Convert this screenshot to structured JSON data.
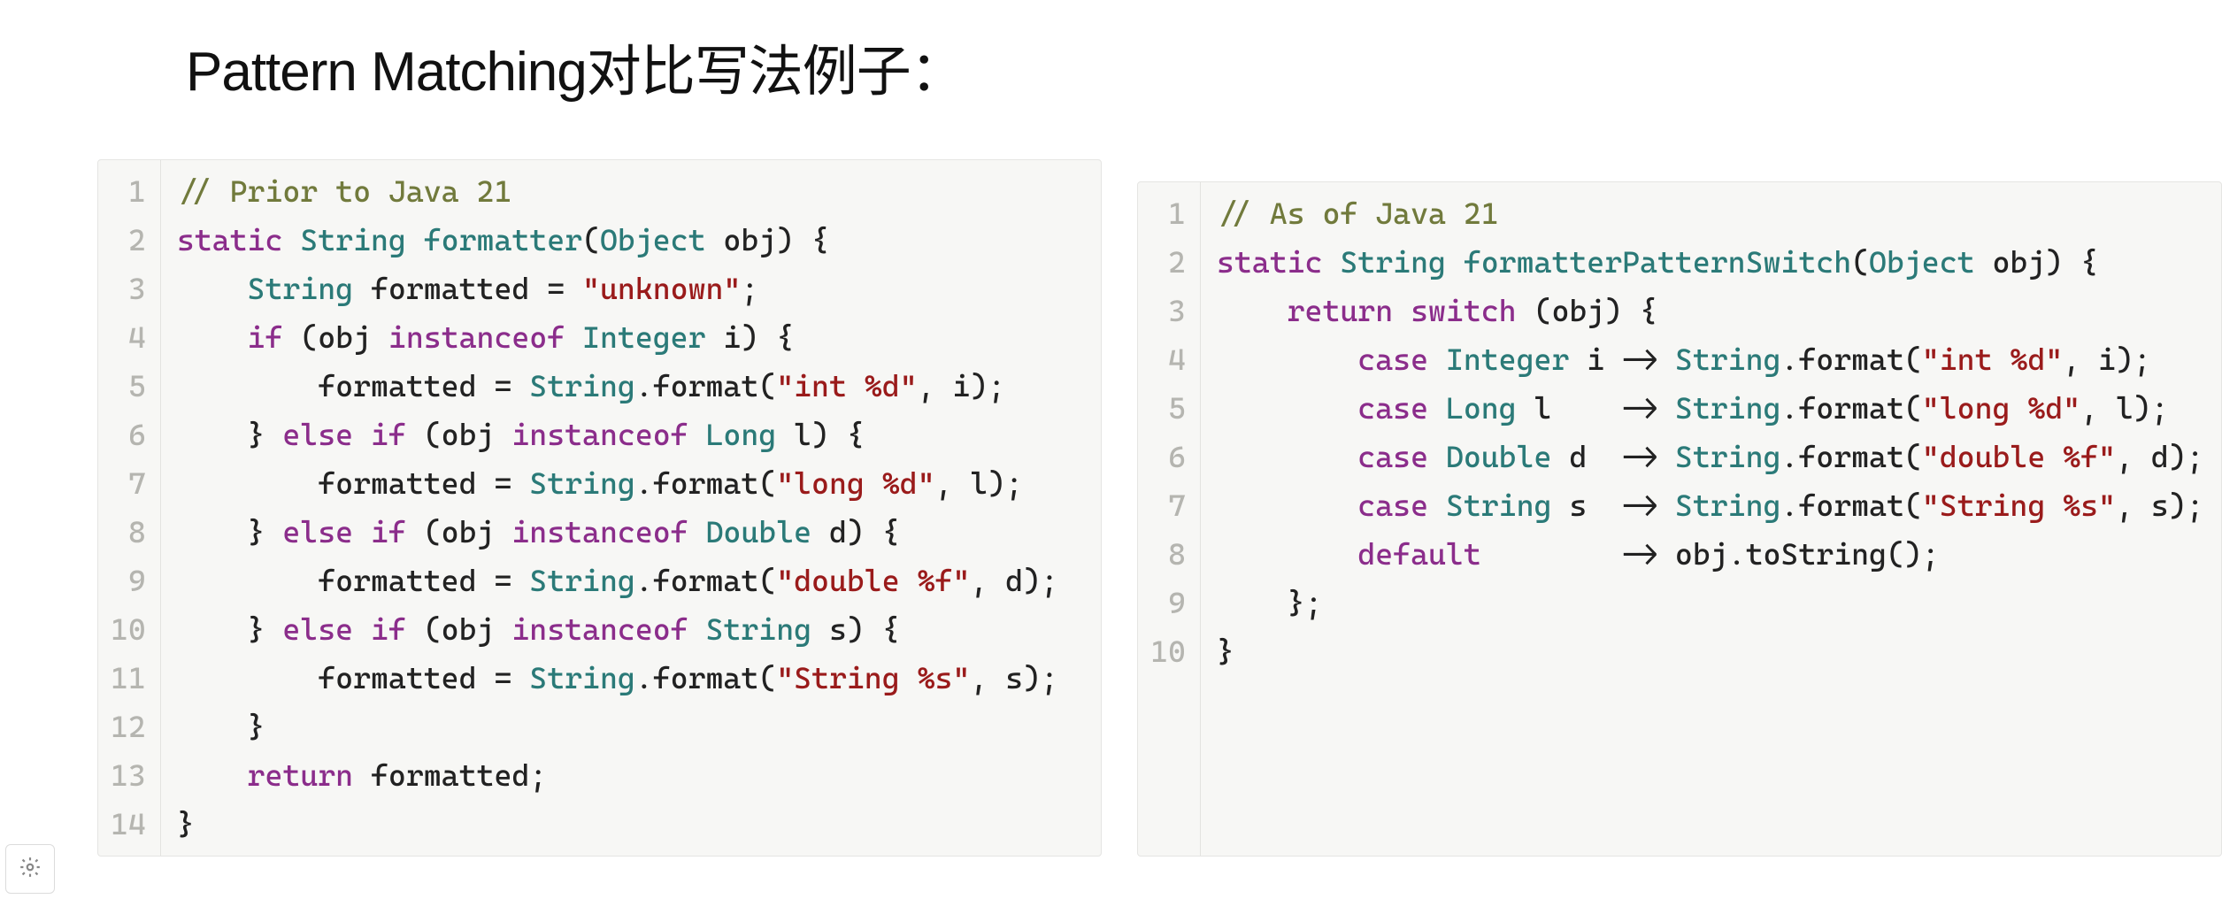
{
  "title": "Pattern Matching对比写法例子：",
  "left": {
    "comment_header": "// Prior to Java 21",
    "lines": [
      [
        {
          "t": "// Prior to Java 21",
          "c": "comment"
        }
      ],
      [
        {
          "t": "static ",
          "c": "keyword"
        },
        {
          "t": "String ",
          "c": "type"
        },
        {
          "t": "formatter",
          "c": "func"
        },
        {
          "t": "(",
          "c": "punct"
        },
        {
          "t": "Object ",
          "c": "type"
        },
        {
          "t": "obj",
          "c": "ident"
        },
        {
          "t": ") {",
          "c": "punct"
        }
      ],
      [
        {
          "t": "    ",
          "c": "punct"
        },
        {
          "t": "String ",
          "c": "type"
        },
        {
          "t": "formatted ",
          "c": "ident"
        },
        {
          "t": "= ",
          "c": "op"
        },
        {
          "t": "\"unknown\"",
          "c": "string"
        },
        {
          "t": ";",
          "c": "punct"
        }
      ],
      [
        {
          "t": "    ",
          "c": "punct"
        },
        {
          "t": "if ",
          "c": "keyword"
        },
        {
          "t": "(obj ",
          "c": "ident"
        },
        {
          "t": "instanceof ",
          "c": "keyword"
        },
        {
          "t": "Integer ",
          "c": "type"
        },
        {
          "t": "i) {",
          "c": "ident"
        }
      ],
      [
        {
          "t": "        formatted ",
          "c": "ident"
        },
        {
          "t": "= ",
          "c": "op"
        },
        {
          "t": "String",
          "c": "type"
        },
        {
          "t": ".format(",
          "c": "ident"
        },
        {
          "t": "\"int %d\"",
          "c": "string"
        },
        {
          "t": ", i);",
          "c": "ident"
        }
      ],
      [
        {
          "t": "    } ",
          "c": "punct"
        },
        {
          "t": "else if ",
          "c": "keyword"
        },
        {
          "t": "(obj ",
          "c": "ident"
        },
        {
          "t": "instanceof ",
          "c": "keyword"
        },
        {
          "t": "Long ",
          "c": "type"
        },
        {
          "t": "l) {",
          "c": "ident"
        }
      ],
      [
        {
          "t": "        formatted ",
          "c": "ident"
        },
        {
          "t": "= ",
          "c": "op"
        },
        {
          "t": "String",
          "c": "type"
        },
        {
          "t": ".format(",
          "c": "ident"
        },
        {
          "t": "\"long %d\"",
          "c": "string"
        },
        {
          "t": ", l);",
          "c": "ident"
        }
      ],
      [
        {
          "t": "    } ",
          "c": "punct"
        },
        {
          "t": "else if ",
          "c": "keyword"
        },
        {
          "t": "(obj ",
          "c": "ident"
        },
        {
          "t": "instanceof ",
          "c": "keyword"
        },
        {
          "t": "Double ",
          "c": "type"
        },
        {
          "t": "d) {",
          "c": "ident"
        }
      ],
      [
        {
          "t": "        formatted ",
          "c": "ident"
        },
        {
          "t": "= ",
          "c": "op"
        },
        {
          "t": "String",
          "c": "type"
        },
        {
          "t": ".format(",
          "c": "ident"
        },
        {
          "t": "\"double %f\"",
          "c": "string"
        },
        {
          "t": ", d);",
          "c": "ident"
        }
      ],
      [
        {
          "t": "    } ",
          "c": "punct"
        },
        {
          "t": "else if ",
          "c": "keyword"
        },
        {
          "t": "(obj ",
          "c": "ident"
        },
        {
          "t": "instanceof ",
          "c": "keyword"
        },
        {
          "t": "String ",
          "c": "type"
        },
        {
          "t": "s) {",
          "c": "ident"
        }
      ],
      [
        {
          "t": "        formatted ",
          "c": "ident"
        },
        {
          "t": "= ",
          "c": "op"
        },
        {
          "t": "String",
          "c": "type"
        },
        {
          "t": ".format(",
          "c": "ident"
        },
        {
          "t": "\"String %s\"",
          "c": "string"
        },
        {
          "t": ", s);",
          "c": "ident"
        }
      ],
      [
        {
          "t": "    }",
          "c": "punct"
        }
      ],
      [
        {
          "t": "    ",
          "c": "punct"
        },
        {
          "t": "return ",
          "c": "keyword"
        },
        {
          "t": "formatted;",
          "c": "ident"
        }
      ],
      [
        {
          "t": "}",
          "c": "punct"
        }
      ]
    ]
  },
  "right": {
    "comment_header": "// As of Java 21",
    "lines": [
      [
        {
          "t": "// As of Java 21",
          "c": "comment"
        }
      ],
      [
        {
          "t": "static ",
          "c": "keyword"
        },
        {
          "t": "String ",
          "c": "type"
        },
        {
          "t": "formatterPatternSwitch",
          "c": "func"
        },
        {
          "t": "(",
          "c": "punct"
        },
        {
          "t": "Object ",
          "c": "type"
        },
        {
          "t": "obj",
          "c": "ident"
        },
        {
          "t": ") {",
          "c": "punct"
        }
      ],
      [
        {
          "t": "    ",
          "c": "punct"
        },
        {
          "t": "return ",
          "c": "keyword"
        },
        {
          "t": "switch ",
          "c": "keyword"
        },
        {
          "t": "(obj) {",
          "c": "ident"
        }
      ],
      [
        {
          "t": "        ",
          "c": "punct"
        },
        {
          "t": "case ",
          "c": "keyword"
        },
        {
          "t": "Integer ",
          "c": "type"
        },
        {
          "t": "i -> ",
          "c": "ident"
        },
        {
          "t": "String",
          "c": "type"
        },
        {
          "t": ".format(",
          "c": "ident"
        },
        {
          "t": "\"int %d\"",
          "c": "string"
        },
        {
          "t": ", i);",
          "c": "ident"
        }
      ],
      [
        {
          "t": "        ",
          "c": "punct"
        },
        {
          "t": "case ",
          "c": "keyword"
        },
        {
          "t": "Long ",
          "c": "type"
        },
        {
          "t": "l    -> ",
          "c": "ident"
        },
        {
          "t": "String",
          "c": "type"
        },
        {
          "t": ".format(",
          "c": "ident"
        },
        {
          "t": "\"long %d\"",
          "c": "string"
        },
        {
          "t": ", l);",
          "c": "ident"
        }
      ],
      [
        {
          "t": "        ",
          "c": "punct"
        },
        {
          "t": "case ",
          "c": "keyword"
        },
        {
          "t": "Double ",
          "c": "type"
        },
        {
          "t": "d  -> ",
          "c": "ident"
        },
        {
          "t": "String",
          "c": "type"
        },
        {
          "t": ".format(",
          "c": "ident"
        },
        {
          "t": "\"double %f\"",
          "c": "string"
        },
        {
          "t": ", d);",
          "c": "ident"
        }
      ],
      [
        {
          "t": "        ",
          "c": "punct"
        },
        {
          "t": "case ",
          "c": "keyword"
        },
        {
          "t": "String ",
          "c": "type"
        },
        {
          "t": "s  -> ",
          "c": "ident"
        },
        {
          "t": "String",
          "c": "type"
        },
        {
          "t": ".format(",
          "c": "ident"
        },
        {
          "t": "\"String %s\"",
          "c": "string"
        },
        {
          "t": ", s);",
          "c": "ident"
        }
      ],
      [
        {
          "t": "        ",
          "c": "punct"
        },
        {
          "t": "default",
          "c": "keyword"
        },
        {
          "t": "        -> obj.toString();",
          "c": "ident"
        }
      ],
      [
        {
          "t": "    };",
          "c": "punct"
        }
      ],
      [
        {
          "t": "}",
          "c": "punct"
        }
      ]
    ]
  },
  "gear": {
    "label": "settings"
  }
}
